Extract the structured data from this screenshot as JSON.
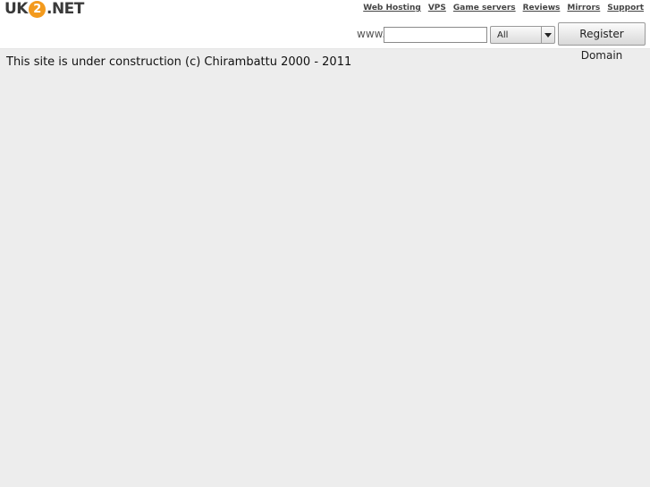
{
  "header": {
    "logo": {
      "prefix": "UK",
      "circle": "2",
      "suffix": ".NET"
    },
    "nav": [
      "Web Hosting",
      "VPS",
      "Game servers",
      "Reviews",
      "Mirrors",
      "Support"
    ]
  },
  "domain_search": {
    "prefix_label": "www.",
    "input_value": "",
    "tld_selected": "All",
    "button_label": "Register Domain"
  },
  "content": {
    "message": "This site is under construction (c) Chirambattu 2000 - 2011"
  },
  "colors": {
    "logo_accent": "#f39a1d",
    "background": "#ededed"
  }
}
